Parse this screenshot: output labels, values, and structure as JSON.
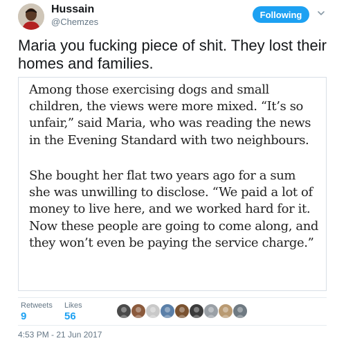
{
  "author": {
    "name": "Hussain",
    "handle": "@Chemzes",
    "avatar_icon": "user-avatar-photo"
  },
  "follow_button": {
    "label": "Following",
    "color": "#1da1f2"
  },
  "menu_icon": "chevron-down-icon",
  "tweet": {
    "text": "Maria you fucking piece of shit. They lost their homes and families."
  },
  "quote": {
    "paragraphs": [
      "Among those exercising dogs and small children, the views were more mixed. “It’s so unfair,” said Maria, who was reading the news in the Evening Standard with two neighbours.",
      "She bought her flat two years ago for a sum she was unwilling to disclose. “We paid a lot of money to live here, and we worked hard for it. Now these people are going to come along, and they won’t even be paying the service charge.”"
    ]
  },
  "stats": {
    "retweets_label": "Retweets",
    "retweets": "9",
    "likes_label": "Likes",
    "likes": "56"
  },
  "liker_avatars": [
    {
      "icon": "liker-avatar-icon",
      "color": "#4a4a4a"
    },
    {
      "icon": "liker-avatar-icon",
      "color": "#8b5a3c"
    },
    {
      "icon": "liker-avatar-icon",
      "color": "#c9c9c9"
    },
    {
      "icon": "liker-avatar-icon",
      "color": "#5a7fa8"
    },
    {
      "icon": "liker-avatar-icon",
      "color": "#7a5230"
    },
    {
      "icon": "liker-avatar-icon",
      "color": "#3b3b3b"
    },
    {
      "icon": "liker-avatar-icon",
      "color": "#9aa0a6"
    },
    {
      "icon": "liker-avatar-icon",
      "color": "#b99a72"
    },
    {
      "icon": "liker-avatar-icon",
      "color": "#6f7a82"
    }
  ],
  "timestamp": "4:53 PM - 21 Jun 2017"
}
